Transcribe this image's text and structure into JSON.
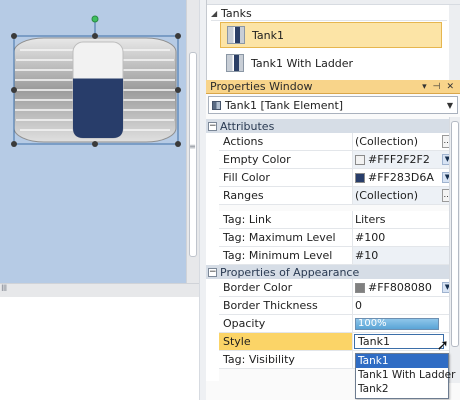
{
  "tanks_panel": {
    "heading": "Tanks",
    "items": [
      {
        "label": "Tank1",
        "selected": true
      },
      {
        "label": "Tank1 With Ladder",
        "selected": false
      }
    ]
  },
  "properties_window": {
    "title": "Properties Window",
    "object_selector": "Tank1 [Tank Element]",
    "categories": [
      {
        "label": "Attributes"
      },
      {
        "label": "Properties of Appearance"
      }
    ],
    "rows": [
      {
        "name": "Actions",
        "value": "(Collection)"
      },
      {
        "name": "Empty Color",
        "value": "#FFF2F2F2",
        "color": "#F2F2F2"
      },
      {
        "name": "Fill Color",
        "value": "#FF283D6A",
        "color": "#283D6A"
      },
      {
        "name": "Ranges",
        "value": "(Collection)"
      },
      {
        "name": "Tag: Link",
        "value": "Liters"
      },
      {
        "name": "Tag: Maximum Level",
        "value": "#100"
      },
      {
        "name": "Tag: Minimum Level",
        "value": "#10"
      },
      {
        "name": "Border Color",
        "value": "#FF808080",
        "color": "#808080"
      },
      {
        "name": "Border Thickness",
        "value": "0"
      },
      {
        "name": "Opacity",
        "value": "100%",
        "level": 1.0
      },
      {
        "name": "Style",
        "value": "Tank1"
      },
      {
        "name": "Tag: Visibility",
        "value": ""
      }
    ],
    "style_options": [
      "Tank1",
      "Tank1 With Ladder",
      "Tank2"
    ]
  },
  "canvas": {
    "tank_fill_level": 0.62,
    "tank_empty_color": "#F2F2F2",
    "tank_fill_color": "#283D6A",
    "background_color": "#B6CBE5"
  }
}
